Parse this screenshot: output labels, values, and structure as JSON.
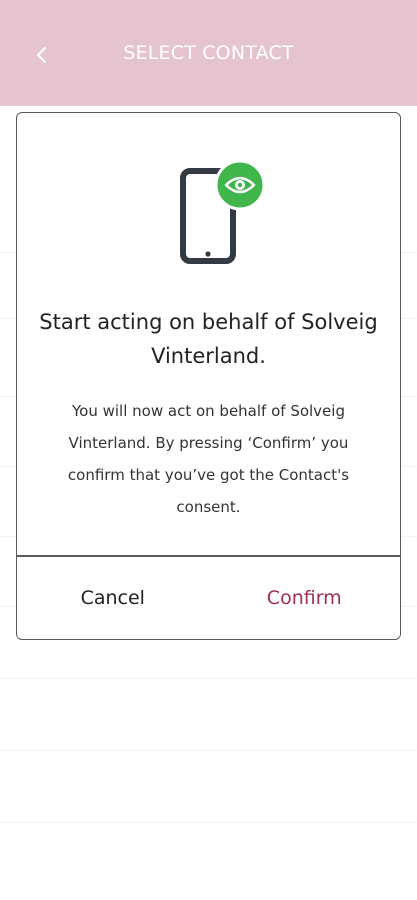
{
  "header": {
    "back_icon": "chevron-left-icon",
    "title": "SELECT CONTACT",
    "background": "#e6c3d0"
  },
  "modal": {
    "icon": "phone-with-eye-icon",
    "icon_badge_color": "#3fb54a",
    "title": "Start acting on behalf of Solveig Vinterland.",
    "body": "You will now act on behalf of Solveig Vinterland. By pressing ‘Confirm’ you confirm that you’ve got the Contact's consent.",
    "cancel_label": "Cancel",
    "confirm_label": "Confirm",
    "confirm_color": "#9c2f55"
  }
}
